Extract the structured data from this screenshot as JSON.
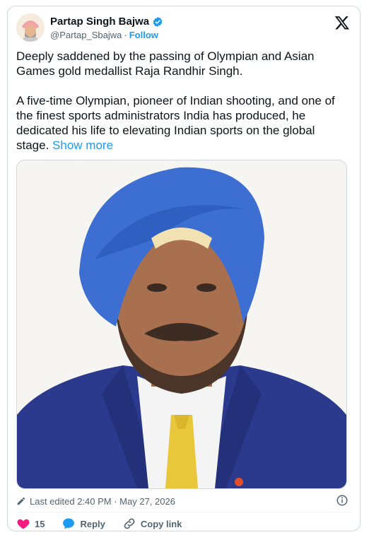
{
  "author": {
    "name": "Partap Singh Bajwa",
    "handle": "@Partap_Sbajwa",
    "separator": "·",
    "follow_label": "Follow"
  },
  "tweet": {
    "text": "Deeply saddened by the passing of Olympian and Asian Games gold medallist Raja Randhir Singh.\n\nA five-time Olympian, pioneer of Indian shooting, and one of the finest sports administrators India has produced, he dedicated his life to elevating Indian sports on the global stage. ",
    "show_more_label": "Show more"
  },
  "meta": {
    "edited_label": "Last edited 2:40 PM · May 27, 2026"
  },
  "actions": {
    "like_count": "15",
    "reply_label": "Reply",
    "copy_link_label": "Copy link"
  },
  "colors": {
    "accent": "#1d9bf0",
    "like": "#f91880",
    "turban": "#3c6fd1",
    "blazer": "#2b3a8c"
  }
}
